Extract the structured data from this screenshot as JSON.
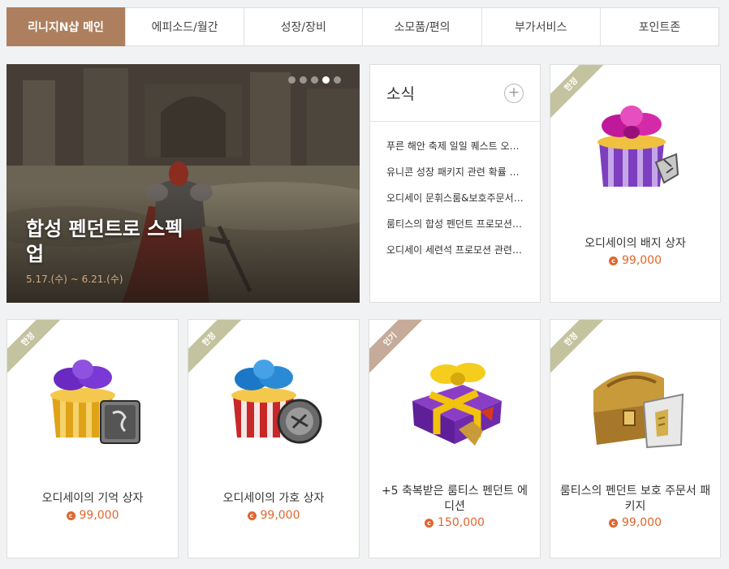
{
  "tabs": [
    {
      "label": "리니지N샵 메인",
      "active": true
    },
    {
      "label": "에피소드/월간",
      "active": false
    },
    {
      "label": "성장/장비",
      "active": false
    },
    {
      "label": "소모품/편의",
      "active": false
    },
    {
      "label": "부가서비스",
      "active": false
    },
    {
      "label": "포인트존",
      "active": false
    }
  ],
  "banner": {
    "title": "합성 펜던트로 스펙업",
    "date": "5.17.(수) ~ 6.21.(수)",
    "slide_count": 5,
    "current_slide": 4
  },
  "news": {
    "title": "소식",
    "more_icon": "plus-icon",
    "items": [
      "푸른 해안 축제 일일 퀘스트 오류 안내",
      "유니콘 성장 패키지 관련 확률 안내",
      "오디세이 문휘스룸&보호주문서 안내",
      "룸티스의 합성 펜던트 프로모션 안내",
      "오디세이 세련석 프로모션 관련 안내"
    ]
  },
  "products": [
    {
      "name": "오디세이의 배지 상자",
      "price": "99,000",
      "badge": "한정"
    },
    {
      "name": "오디세이의 기억 상자",
      "price": "99,000",
      "badge": "한정"
    },
    {
      "name": "오디세이의 가호 상자",
      "price": "99,000",
      "badge": "한정"
    },
    {
      "name": "+5 축복받은 룸티스 펜던트 에디션",
      "price": "150,000",
      "badge": "인기"
    },
    {
      "name": "룸티스의 펜던트 보호 주문서 패키지",
      "price": "99,000",
      "badge": "한정"
    }
  ],
  "currency_icon": "coin-icon",
  "colors": {
    "active_tab": "#ad7f5e",
    "price": "#e0662e",
    "badge_limited": "#c4c39f",
    "badge_popular": "#c6ab9a",
    "banner_date": "#d4a978"
  }
}
